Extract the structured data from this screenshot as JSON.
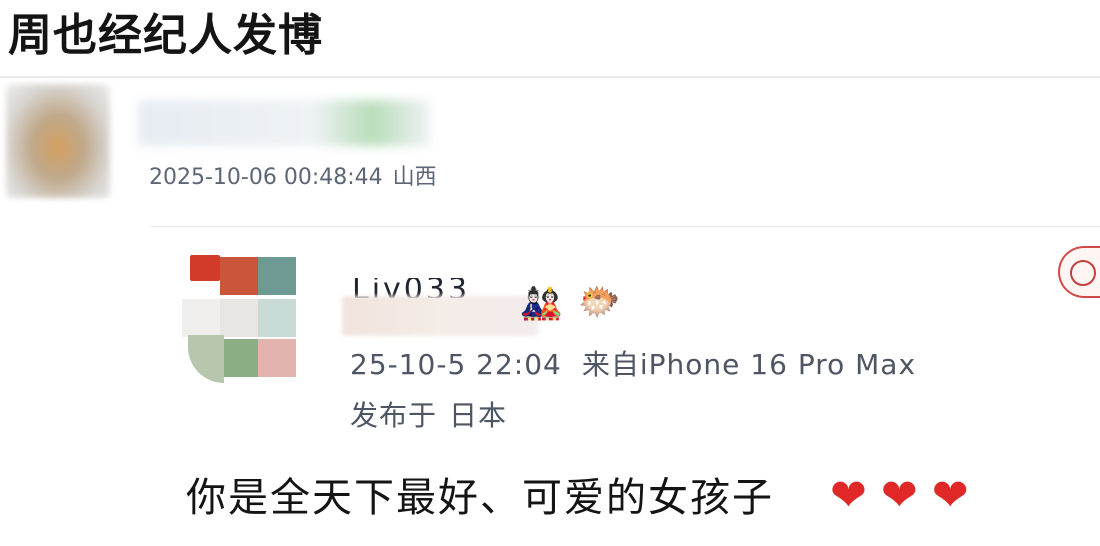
{
  "headline": "周也经纪人发博",
  "post": {
    "timestamp": "2025-10-06 00:48:44",
    "location": "山西"
  },
  "reply": {
    "name_partial": "Liv033",
    "emojis": [
      "🎎",
      "🐡"
    ],
    "timestamp": "25-10-5 22:04",
    "source": "来自iPhone 16 Pro Max",
    "published_label": "发布于",
    "published_location": "日本",
    "text": "你是全天下最好、可爱的女孩子",
    "hearts": "❤❤❤"
  },
  "icons": {
    "post_avatar": "blurred-avatar",
    "reply_avatar": "mosaic-avatar",
    "edge_badge": "reaction-badge-icon"
  },
  "colors": {
    "text_primary": "#141414",
    "text_meta": "#5d6675",
    "heart": "#e02828"
  }
}
